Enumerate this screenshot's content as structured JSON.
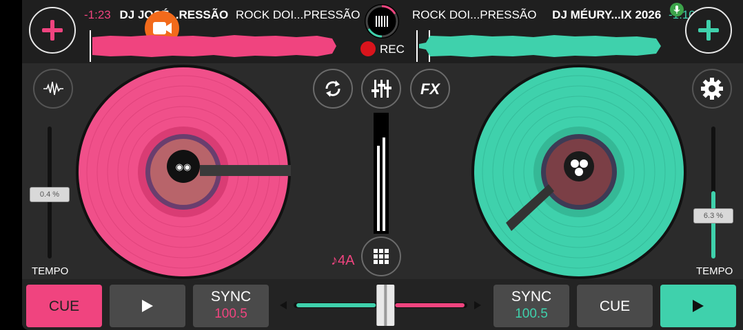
{
  "deck_a": {
    "time_remaining": "-1:23",
    "artist": "DJ JOSÉ...RESSÃO",
    "title": "ROCK DOI...PRESSÃO",
    "tempo_value": "0.4 %",
    "tempo_label": "TEMPO",
    "key": "♪4A",
    "cue_label": "CUE",
    "sync_label": "SYNC",
    "sync_bpm": "100.5",
    "color": "#f0447f"
  },
  "deck_b": {
    "title": "ROCK DOI...PRESSÃO",
    "artist": "DJ MÉURY...IX 2026",
    "time_remaining": "-1:10",
    "tempo_value": "6.3 %",
    "tempo_label": "TEMPO",
    "cue_label": "CUE",
    "sync_label": "SYNC",
    "sync_bpm": "100.5",
    "color": "#3fd1ac"
  },
  "center": {
    "rec_label": "REC",
    "fx_label": "FX"
  },
  "crossfader": {
    "position": 0.53
  },
  "icons": {
    "add_track_a": "plus-icon",
    "add_track_b": "plus-icon",
    "record_menu": "equalizer-bars-icon",
    "waveform": "waveform-icon",
    "sync_loop": "loop-icon",
    "mixer": "sliders-icon",
    "settings": "gear-icon",
    "sampler": "grid-icon",
    "play": "play-icon",
    "screen_record": "video-camera-icon",
    "mic": "microphone-icon"
  }
}
